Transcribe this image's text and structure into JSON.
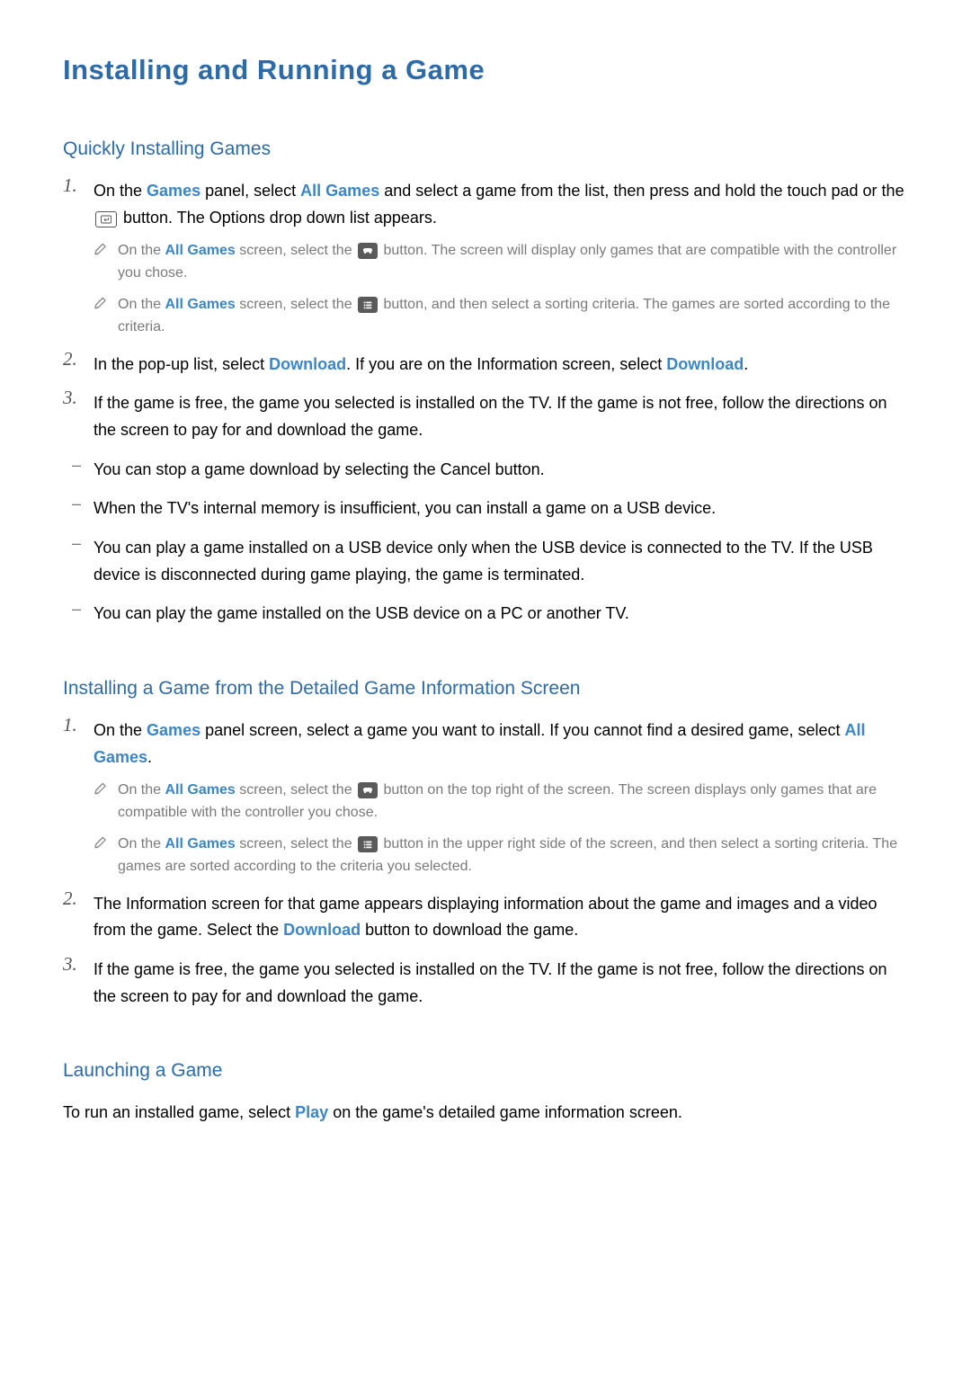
{
  "title": "Installing and Running a Game",
  "section1": {
    "heading": "Quickly Installing Games",
    "step1": {
      "pre": "On the ",
      "link1": "Games",
      "mid1": " panel, select ",
      "link2": "All Games",
      "mid2": " and select a game from the list, then press and hold the touch pad or the ",
      "post": " button. The Options drop down list appears."
    },
    "note1": {
      "pre": "On the ",
      "link": "All Games",
      "mid": " screen, select the ",
      "post": " button. The screen will display only games that are compatible with the controller you chose."
    },
    "note2": {
      "pre": "On the ",
      "link": "All Games",
      "mid": " screen, select the ",
      "post": " button, and then select a sorting criteria. The games are sorted according to the criteria."
    },
    "step2": {
      "pre": "In the pop-up list, select ",
      "link1": "Download",
      "mid": ". If you are on the Information screen, select ",
      "link2": "Download",
      "post": "."
    },
    "step3": "If the game is free, the game you selected is installed on the TV. If the game is not free, follow the directions on the screen to pay for and download the game.",
    "dash1": "You can stop a game download by selecting the Cancel button.",
    "dash2": "When the TV's internal memory is insufficient, you can install a game on a USB device.",
    "dash3": "You can play a game installed on a USB device only when the USB device is connected to the TV. If the USB device is disconnected during game playing, the game is terminated.",
    "dash4": "You can play the game installed on the USB device on a PC or another TV."
  },
  "section2": {
    "heading": "Installing a Game from the Detailed Game Information Screen",
    "step1": {
      "pre": "On the ",
      "link1": "Games",
      "mid1": " panel screen, select a game you want to install. If you cannot find a desired game, select ",
      "link2": "All Games",
      "post": "."
    },
    "note1": {
      "pre": "On the ",
      "link": "All Games",
      "mid": " screen, select the ",
      "post": " button on the top right of the screen. The screen displays only games that are compatible with the controller you chose."
    },
    "note2": {
      "pre": "On the ",
      "link": "All Games",
      "mid": " screen, select the ",
      "post": " button in the upper right side of the screen, and then select a sorting criteria. The games are sorted according to the criteria you selected."
    },
    "step2": {
      "pre": "The Information screen for that game appears displaying information about the game and images and a video from the game. Select the ",
      "link": "Download",
      "post": " button to download the game."
    },
    "step3": "If the game is free, the game you selected is installed on the TV. If the game is not free, follow the directions on the screen to pay for and download the game."
  },
  "section3": {
    "heading": "Launching a Game",
    "para": {
      "pre": "To run an installed game, select ",
      "link": "Play",
      "post": " on the game's detailed game information screen."
    }
  },
  "icons": {
    "pencil": "note-icon",
    "enter": "enter-button-icon",
    "controller": "controller-button-icon",
    "list": "list-button-icon"
  }
}
